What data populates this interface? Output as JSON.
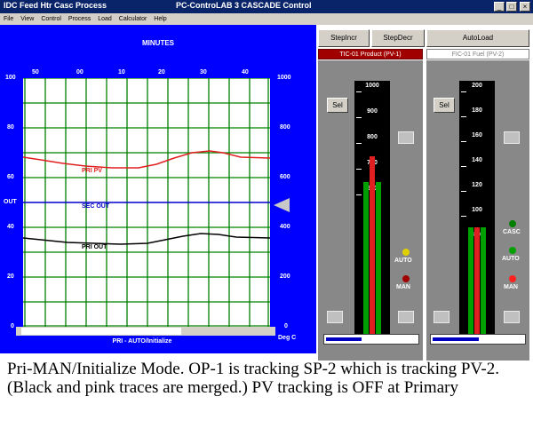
{
  "window": {
    "app_title": "IDC Feed Htr Casc Process",
    "title": "PC-ControLAB 3 CASCADE Control",
    "buttons": [
      "_",
      "□",
      "×"
    ]
  },
  "menu": [
    "File",
    "View",
    "Control",
    "Process",
    "Load",
    "Calculator",
    "Help"
  ],
  "trend": {
    "minutes_label": "MINUTES",
    "time_ticks": [
      "50",
      "00",
      "10",
      "20",
      "30",
      "40"
    ],
    "left_ticks": [
      "100",
      "80",
      "60",
      "OUT",
      "40",
      "20",
      "0"
    ],
    "right_ticks": [
      "1000",
      "800",
      "600",
      "400",
      "200",
      "0"
    ],
    "traces": {
      "pri_pv": {
        "label": "PRI PV",
        "color": "#e02020"
      },
      "sec_out": {
        "label": "SEC OUT",
        "color": "#0000cc"
      },
      "pri_out": {
        "label": "PRI OUT",
        "color": "#000000"
      }
    },
    "status": "PRI - AUTO/Initialize",
    "units": "Deg C"
  },
  "toolbar": {
    "step_incr": "StepIncr",
    "step_decr": "StepDecr",
    "autoload": "AutoLoad"
  },
  "primary": {
    "title": "TIC-01 Product (PV-1)",
    "sel": "Sel",
    "scale": [
      "1000",
      "900",
      "800",
      "700",
      "600"
    ],
    "pv_fraction": 0.7,
    "sp_fraction": 0.6,
    "lamps": [
      {
        "label": "AUTO",
        "color": "#e0d000"
      },
      {
        "label": "MAN",
        "color": "#a00000"
      }
    ]
  },
  "secondary": {
    "title": "FIC-01 Fuel (PV-2)",
    "sel": "Sel",
    "scale": [
      "200",
      "180",
      "160",
      "140",
      "120",
      "100",
      "80"
    ],
    "pv_fraction": 0.42,
    "sp_fraction": 0.42,
    "lamps": [
      {
        "label": "CASC",
        "color": "#008000"
      },
      {
        "label": "AUTO",
        "color": "#00a000"
      },
      {
        "label": "MAN",
        "color": "#ff2020"
      }
    ]
  },
  "caption": "Pri-MAN/Initialize Mode. OP-1 is tracking SP-2 which is tracking PV-2. (Black and pink traces are merged.) PV tracking is OFF at Primary"
}
